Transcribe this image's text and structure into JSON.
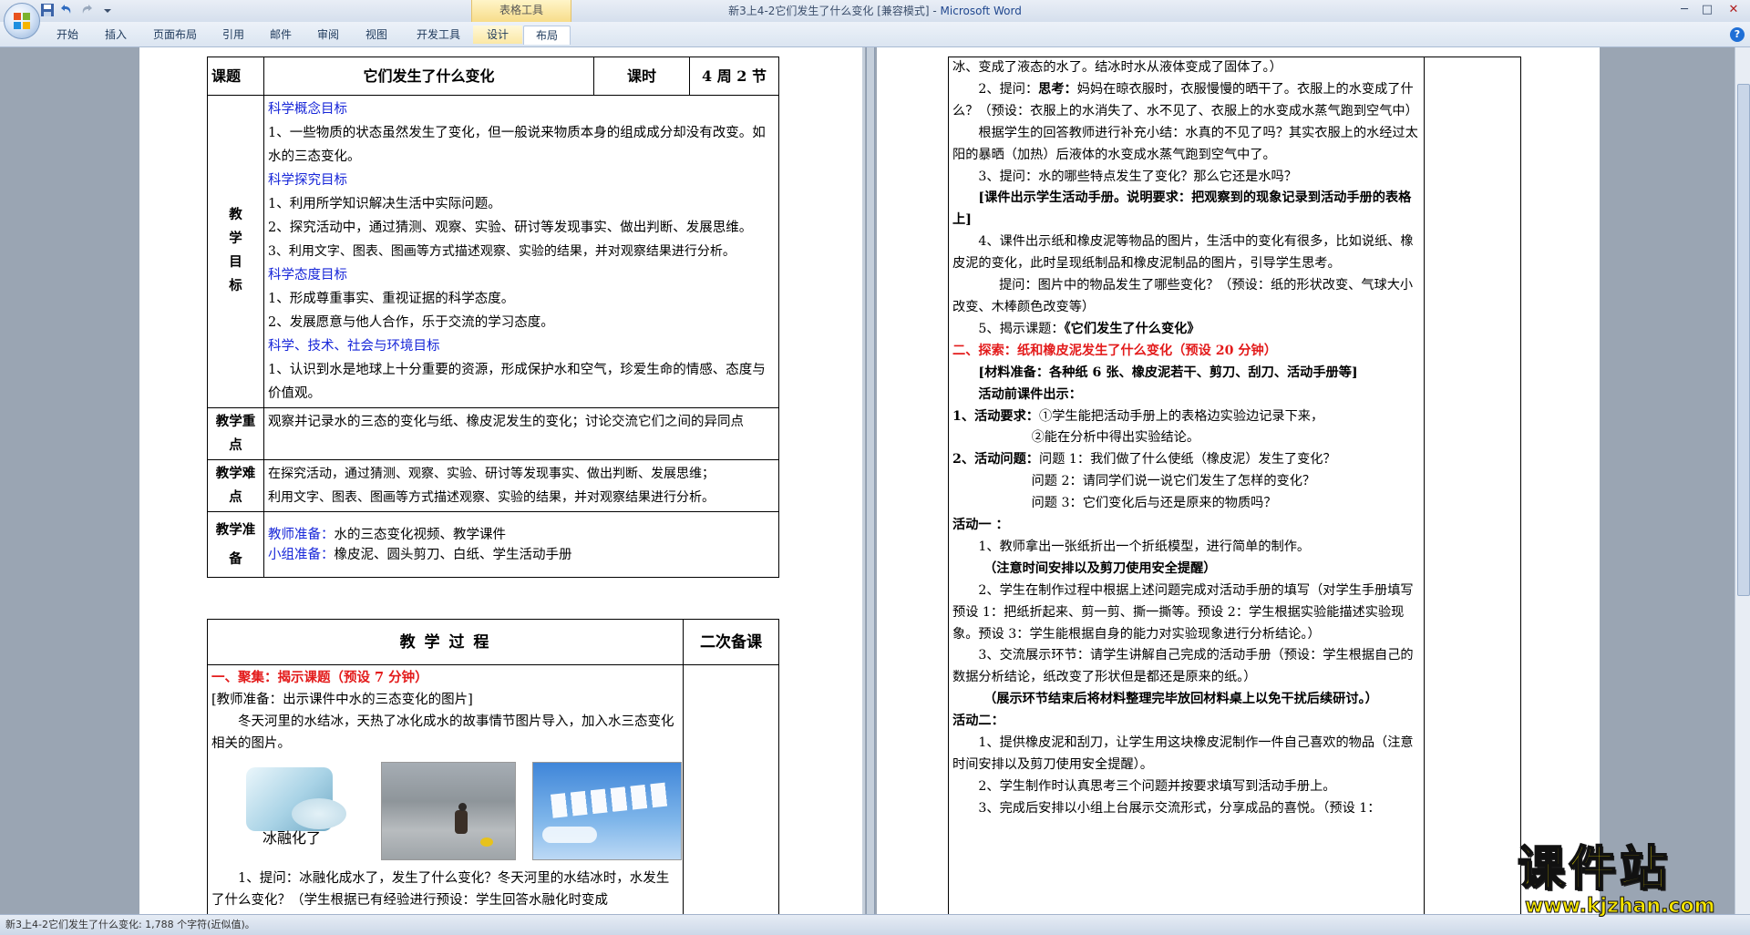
{
  "window": {
    "title": "新3上4-2它们发生了什么变化 [兼容模式] - ",
    "app_name": "Microsoft Word",
    "context_group": "表格工具",
    "controls": {
      "minimize": "─",
      "maximize": "□",
      "close": "✕"
    }
  },
  "ribbon": {
    "tabs": [
      {
        "label": "开始"
      },
      {
        "label": "插入"
      },
      {
        "label": "页面布局"
      },
      {
        "label": "引用"
      },
      {
        "label": "邮件"
      },
      {
        "label": "审阅"
      },
      {
        "label": "视图"
      },
      {
        "label": "开发工具"
      },
      {
        "label": "设计"
      },
      {
        "label": "布局"
      }
    ],
    "active_tab": "布局",
    "help": "?"
  },
  "page1": {
    "header_row": {
      "label": "课题",
      "title": "它们发生了什么变化",
      "period_label": "课时",
      "period_value": "4 周 2 节"
    },
    "goals_label": [
      "教",
      "学",
      "目",
      "标"
    ],
    "goals": [
      {
        "kind": "heading",
        "text": "科学概念目标"
      },
      {
        "kind": "text",
        "text": "1、一些物质的状态虽然发生了变化，但一般说来物质本身的组成成分却没有改变。如水的三态变化。"
      },
      {
        "kind": "heading",
        "text": "科学探究目标"
      },
      {
        "kind": "text",
        "text": "1、利用所学知识解决生活中实际问题。"
      },
      {
        "kind": "text",
        "text": "2、探究活动中，通过猜测、观察、实验、研讨等发现事实、做出判断、发展思维。"
      },
      {
        "kind": "text",
        "text": "3、利用文字、图表、图画等方式描述观察、实验的结果，并对观察结果进行分析。"
      },
      {
        "kind": "heading",
        "text": "科学态度目标"
      },
      {
        "kind": "text",
        "text": "1、形成尊重事实、重视证据的科学态度。"
      },
      {
        "kind": "text",
        "text": "2、发展愿意与他人合作，乐于交流的学习态度。"
      },
      {
        "kind": "heading",
        "text": "科学、技术、社会与环境目标"
      },
      {
        "kind": "text",
        "text": "1、认识到水是地球上十分重要的资源，形成保护水和空气，珍爱生命的情感、态度与价值观。"
      }
    ],
    "key_points": {
      "label": "教学重点",
      "text": "观察并记录水的三态的变化与纸、橡皮泥发生的变化；讨论交流它们之间的异同点"
    },
    "difficulties": {
      "label": "教学难点",
      "lines": [
        "在探究活动，通过猜测、观察、实验、研讨等发现事实、做出判断、发展思维；",
        "利用文字、图表、图画等方式描述观察、实验的结果，并对观察结果进行分析。"
      ]
    },
    "preparation": {
      "label": "教学准备",
      "teacher_label": "教师准备：",
      "teacher_text": "水的三态变化视频、教学课件",
      "group_label": "小组准备：",
      "group_text": "橡皮泥、圆头剪刀、白纸、学生活动手册"
    },
    "process_header": {
      "title": "教 学 过 程",
      "second_prep": "二次备课"
    },
    "process": {
      "section1": "一、聚集：揭示课题（预设 7 分钟）",
      "prep_note": "[教师准备：出示课件中水的三态变化的图片]",
      "intro": "冬天河里的水结冰，天热了冰化成水的故事情节图片导入，加入水三态变化相关的图片。",
      "image1_caption": "冰融化了",
      "q1": "1、提问：冰融化成水了，发生了什么变化？冬天河里的水结冰时，水发生了什么变化？（学生根据已有经验进行预设：学生回答水融化时变成"
    }
  },
  "page2": {
    "lines": [
      {
        "style": "plain",
        "text": "冰、变成了液态的水了。结冰时水从液体变成了固体了。）"
      },
      {
        "style": "ind",
        "prefix": "2、提问：",
        "bold": "思考：",
        "text": "妈妈在晾衣服时，衣服慢慢的晒干了。衣服上的水变成了什么？（预设：衣服上的水消失了、水不见了、衣服上的水变成水蒸气跑到空气中）"
      },
      {
        "style": "ind",
        "text": "根据学生的回答教师进行补充小结：水真的不见了吗？其实衣服上的水经过太阳的暴晒（加热）后液体的水变成水蒸气跑到空气中了。"
      },
      {
        "style": "ind",
        "text": "3、提问：水的哪些特点发生了变化？那么它还是水吗？"
      },
      {
        "style": "indbold",
        "text": "[课件出示学生活动手册。说明要求：把观察到的现象记录到活动手册的表格上]"
      },
      {
        "style": "ind",
        "text": "4、课件出示纸和橡皮泥等物品的图片，生活中的变化有很多，比如说纸、橡皮泥的变化，此时呈现纸制品和橡皮泥制品的图片，引导学生思考。"
      },
      {
        "style": "ind3",
        "text": "提问：图片中的物品发生了哪些变化？（预设：纸的形状改变、气球大小改变、木棒颜色改变等）"
      },
      {
        "style": "ind",
        "prefix": "5、揭示课题：",
        "bold": "《它们发生了什么变化》"
      },
      {
        "style": "red",
        "text": "二、探索：纸和橡皮泥发生了什么变化（预设 20 分钟）"
      },
      {
        "style": "indbold",
        "text": "[材料准备：各种纸 6 张、橡皮泥若干、剪刀、刮刀、活动手册等]"
      },
      {
        "style": "indbold",
        "text": "活动前课件出示："
      },
      {
        "style": "plainbold",
        "bold": "1、活动要求：",
        "text": "①学生能把活动手册上的表格边实验边记录下来，"
      },
      {
        "style": "hang",
        "text": "②能在分析中得出实验结论。"
      },
      {
        "style": "plainbold",
        "bold": "2、活动问题：",
        "text": "问题 1：我们做了什么使纸（橡皮泥）发生了变化？"
      },
      {
        "style": "hang",
        "text": "问题 2：请同学们说一说它们发生了怎样的变化？"
      },
      {
        "style": "hang",
        "text": "问题 3：它们变化后与还是原来的物质吗？"
      },
      {
        "style": "plainbold",
        "bold": "活动一 ：",
        "text": ""
      },
      {
        "style": "ind",
        "text": "1、教师拿出一张纸折出一个折纸模型，进行简单的制作。"
      },
      {
        "style": "ind3bold",
        "text": "（注意时间安排以及剪刀使用安全提醒）"
      },
      {
        "style": "ind",
        "text": "2、学生在制作过程中根据上述问题完成对活动手册的填写（对学生手册填写预设 1：把纸折起来、剪一剪、撕一撕等。预设 2：学生根据实验能描述实验现象。预设 3：学生能根据自身的能力对实验现象进行分析结论。）"
      },
      {
        "style": "ind",
        "text": "3、交流展示环节：请学生讲解自己完成的活动手册（预设：学生根据自己的数据分析结论，纸改变了形状但是都还是原来的纸。）"
      },
      {
        "style": "ind3bold",
        "text": "（展示环节结束后将材料整理完毕放回材料桌上以免干扰后续研讨。）"
      },
      {
        "style": "plainbold",
        "bold": "活动二：",
        "text": ""
      },
      {
        "style": "ind",
        "text": "1、提供橡皮泥和刮刀，让学生用这块橡皮泥制作一件自己喜欢的物品（注意时间安排以及剪刀使用安全提醒）。"
      },
      {
        "style": "ind",
        "text": "2、学生制作时认真思考三个问题并按要求填写到活动手册上。"
      },
      {
        "style": "ind",
        "text": "3、完成后安排以小组上台展示交流形式，分享成品的喜悦。（预设 1："
      }
    ]
  },
  "status_bar": {
    "text": "新3上4-2它们发生了什么变化: 1,788 个字符(近似值)。"
  },
  "watermark": {
    "big": "课件站",
    "url": "www.kjzhan.com"
  },
  "colors": {
    "heading_blue": "#1726d8",
    "section_red": "#e31b1b",
    "watermark_yellow": "#f5e400"
  },
  "icons": [
    "office-button-icon",
    "save-icon",
    "undo-icon",
    "redo-icon",
    "customize-qat-icon",
    "help-icon"
  ]
}
